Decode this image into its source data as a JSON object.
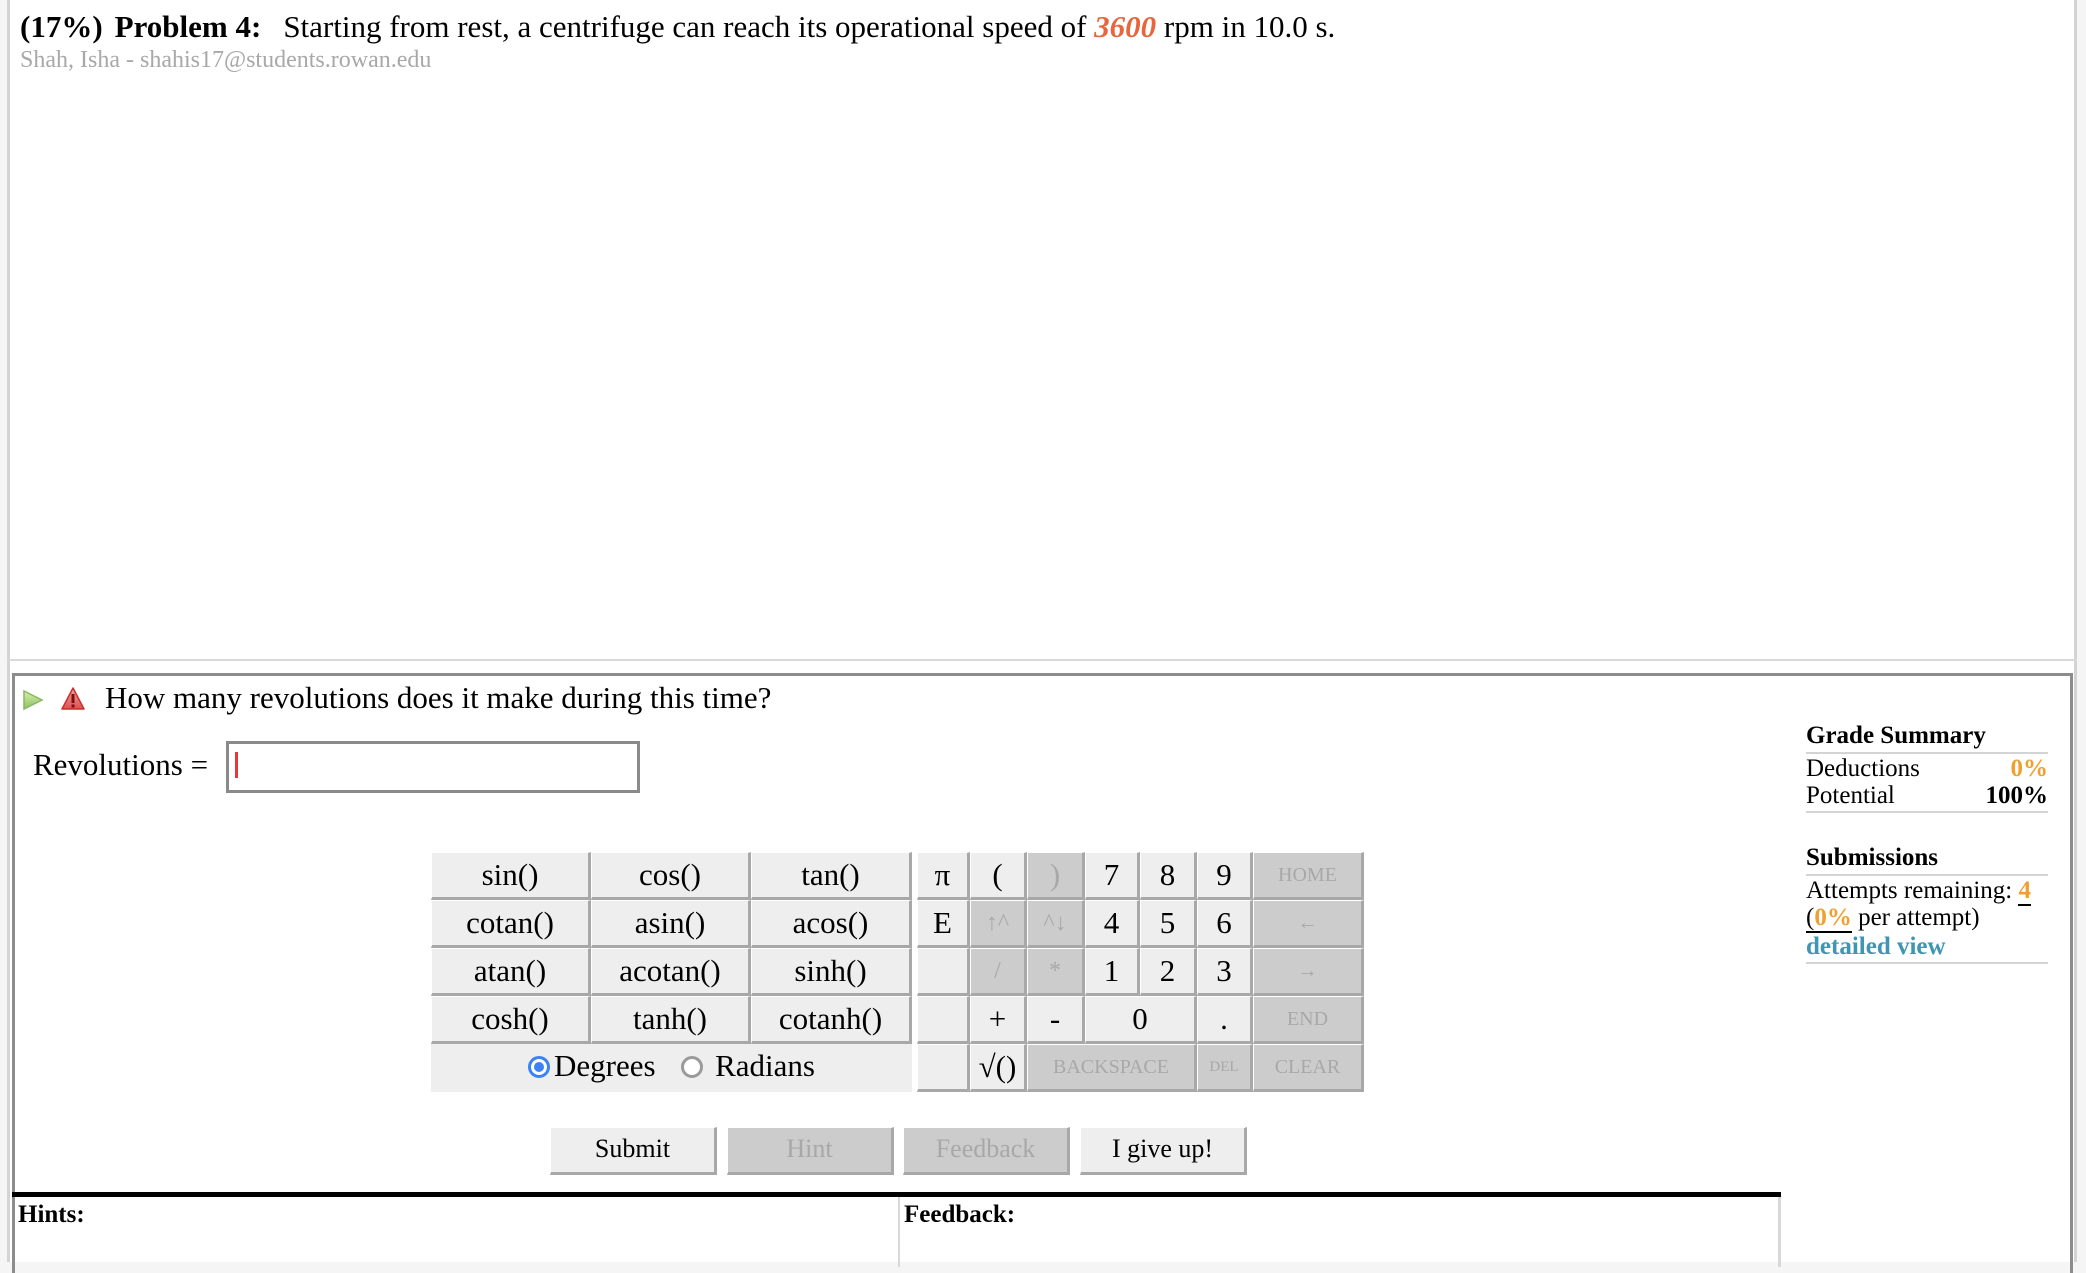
{
  "problem": {
    "weight": "(17%)",
    "number_label": "Problem 4:",
    "text_before": "Starting from rest, a centrifuge can reach its operational speed of ",
    "highlight_value": "3600",
    "text_after": " rpm in 10.0 s.",
    "student": "Shah, Isha - shahis17@students.rowan.edu"
  },
  "question": {
    "text": "How many revolutions does it make during this time?",
    "answer_label": "Revolutions =",
    "answer_value": "",
    "icons": [
      "play-icon",
      "warning-icon"
    ]
  },
  "functions": [
    [
      "sin()",
      "cos()",
      "tan()"
    ],
    [
      "cotan()",
      "asin()",
      "acos()"
    ],
    [
      "atan()",
      "acotan()",
      "sinh()"
    ],
    [
      "cosh()",
      "tanh()",
      "cotanh()"
    ]
  ],
  "angle_mode": {
    "options": [
      "Degrees",
      "Radians"
    ],
    "selected": "Degrees"
  },
  "keypad": {
    "pi": "π",
    "open_paren": "(",
    "close_paren": ")",
    "e": "E",
    "up_caret": "↑^",
    "caret_down": "^↓",
    "divide": "/",
    "multiply": "*",
    "plus": "+",
    "minus": "-",
    "sqrt": "√()",
    "digits": [
      "7",
      "8",
      "9",
      "4",
      "5",
      "6",
      "1",
      "2",
      "3",
      "0"
    ],
    "dot": ".",
    "home": "HOME",
    "left": "←",
    "right": "→",
    "end": "END",
    "backspace": "BACKSPACE",
    "del": "DEL",
    "clear": "CLEAR"
  },
  "buttons": {
    "submit": "Submit",
    "hint": "Hint",
    "feedback": "Feedback",
    "give_up": "I give up!"
  },
  "grade_summary": {
    "title": "Grade Summary",
    "deductions_label": "Deductions",
    "deductions_value": "0%",
    "potential_label": "Potential",
    "potential_value": "100%"
  },
  "submissions": {
    "title": "Submissions",
    "attempts_label": "Attempts remaining: ",
    "attempts_value": "4",
    "per_attempt_open": "(",
    "per_attempt_value": "0%",
    "per_attempt_text": " per attempt)",
    "detailed_view": "detailed view"
  },
  "panels": {
    "hints_label": "Hints:",
    "feedback_label": "Feedback:"
  },
  "colors": {
    "highlight": "#e8663d",
    "orange": "#f0a030",
    "link": "#3f96b4",
    "radio": "#3b82f6"
  }
}
